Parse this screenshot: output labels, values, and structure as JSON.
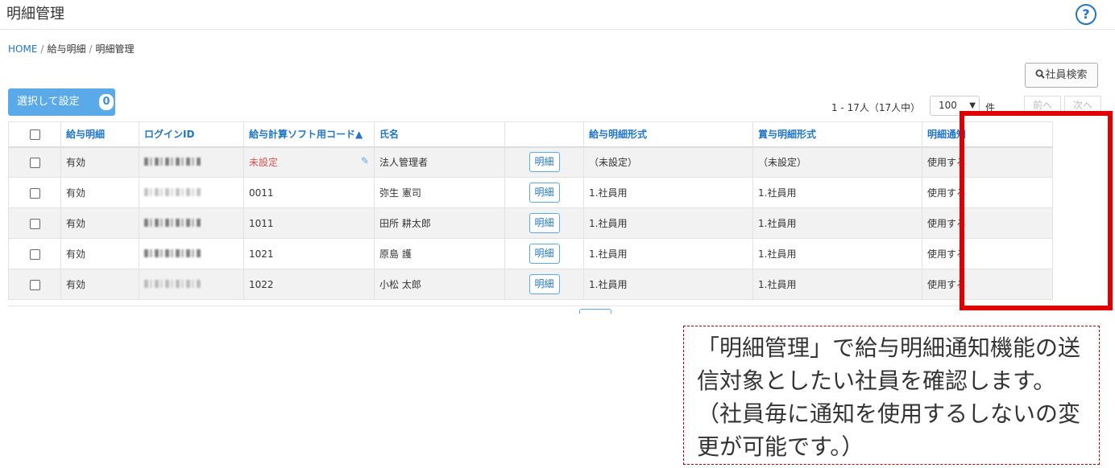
{
  "header": {
    "title": "明細管理",
    "help_icon": "?"
  },
  "breadcrumb": {
    "home": "HOME",
    "sep": "/",
    "item1": "給与明細",
    "item2": "明細管理"
  },
  "toolbar": {
    "search_label": "社員検索",
    "select_label": "選択して設定",
    "select_count": "0"
  },
  "pager": {
    "range": "1 - 17人（17人中）",
    "per_page": "100",
    "unit": "件",
    "prev": "前へ",
    "next": "次へ"
  },
  "table": {
    "headers": [
      "給与明細",
      "ログインID",
      "給与計算ソフト用コード▲",
      "氏名",
      "",
      "給与明細形式",
      "賞与明細形式",
      "明細通知"
    ],
    "rows": [
      {
        "status": "有効",
        "code": "未設定",
        "name": "法人管理者",
        "detail": "明細",
        "salary_format": "（未設定）",
        "bonus_format": "（未設定）",
        "notify": "使用する"
      },
      {
        "status": "有効",
        "code": "0011",
        "name": "弥生 憲司",
        "detail": "明細",
        "salary_format": "1.社員用",
        "bonus_format": "1.社員用",
        "notify": "使用する"
      },
      {
        "status": "有効",
        "code": "1011",
        "name": "田所 耕太郎",
        "detail": "明細",
        "salary_format": "1.社員用",
        "bonus_format": "1.社員用",
        "notify": "使用する"
      },
      {
        "status": "有効",
        "code": "1021",
        "name": "原島 護",
        "detail": "明細",
        "salary_format": "1.社員用",
        "bonus_format": "1.社員用",
        "notify": "使用する"
      },
      {
        "status": "有効",
        "code": "1022",
        "name": "小松 太郎",
        "detail": "明細",
        "salary_format": "1.社員用",
        "bonus_format": "1.社員用",
        "notify": "使用する"
      }
    ]
  },
  "callout": {
    "text": "「明細管理」で給与明細通知機能の送信対象としたい社員を確認します。（社員毎に通知を使用するしないの変更が可能です。）"
  },
  "colors": {
    "accent": "#1f76c9",
    "button": "#5aa9e9",
    "highlight": "#e00000",
    "unset": "#d9534f"
  }
}
